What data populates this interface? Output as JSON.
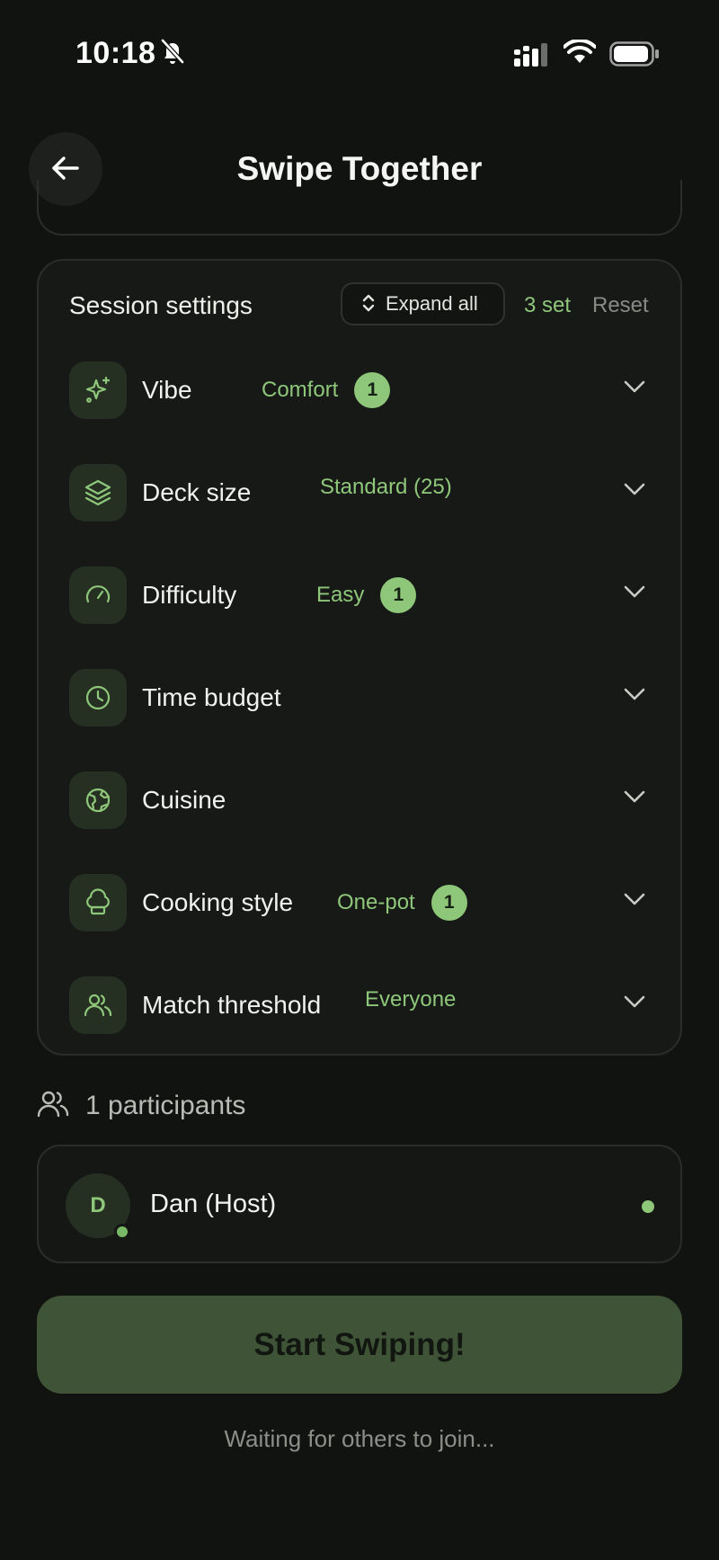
{
  "status_bar": {
    "time": "10:18",
    "icons": [
      "bell-slash-icon",
      "signal-icon",
      "wifi-icon",
      "battery-icon"
    ]
  },
  "header": {
    "title": "Swipe Together",
    "back_icon": "arrow-left-icon"
  },
  "settings": {
    "title": "Session settings",
    "expand_label": "Expand all",
    "set_count": "3 set",
    "reset_label": "Reset",
    "rows": [
      {
        "label": "Vibe",
        "value": "Comfort",
        "badge": "1",
        "icon": "sparkles-icon"
      },
      {
        "label": "Deck size",
        "value": "Standard (25)",
        "badge": "",
        "icon": "layers-icon"
      },
      {
        "label": "Difficulty",
        "value": "Easy",
        "badge": "1",
        "icon": "gauge-icon"
      },
      {
        "label": "Time budget",
        "value": "",
        "badge": "",
        "icon": "clock-icon"
      },
      {
        "label": "Cuisine",
        "value": "",
        "badge": "",
        "icon": "globe-icon"
      },
      {
        "label": "Cooking style",
        "value": "One-pot",
        "badge": "1",
        "icon": "chef-hat-icon"
      },
      {
        "label": "Match threshold",
        "value": "Everyone",
        "badge": "",
        "icon": "users-icon"
      }
    ]
  },
  "participants": {
    "heading": "1 participants",
    "list": [
      {
        "initial": "D",
        "name": "Dan (Host)"
      }
    ]
  },
  "actions": {
    "start_label": "Start Swiping!",
    "waiting_text": "Waiting for others to join..."
  },
  "colors": {
    "background": "#111311",
    "accent": "#8fc77a",
    "card": "#171917",
    "button": "#3f5436"
  }
}
